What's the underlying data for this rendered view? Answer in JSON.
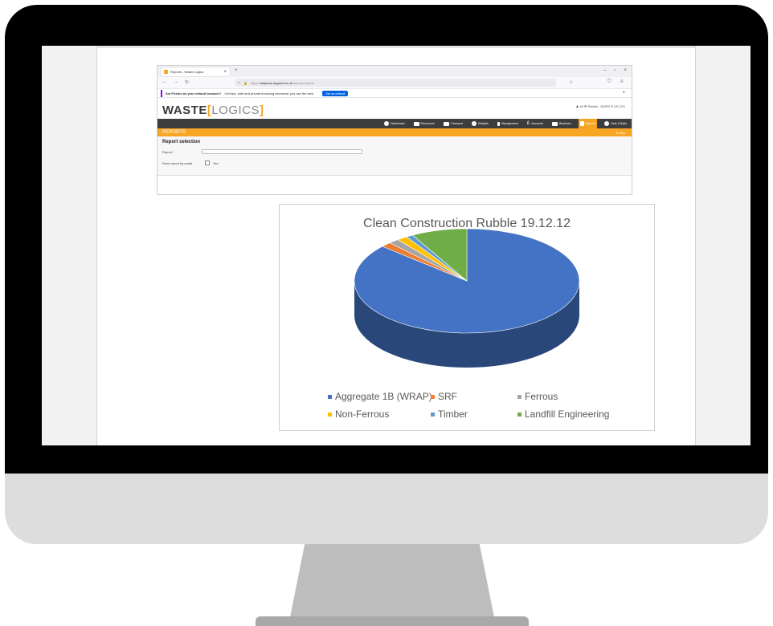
{
  "browser": {
    "tab_title": "Reports - Waste Logics",
    "tab_close": "×",
    "new_tab": "+",
    "win_minimize": "–",
    "win_maximize": "▫",
    "win_close": "×",
    "url_prefix": "https://",
    "url_host": "skipsrus.myyard.co.uk",
    "url_path": "/reports/reports",
    "notification_bold": "Set Firefox as your default browser?",
    "notification_text": "Get fast, safe and private browsing whenever you use the web.",
    "notification_button": "Set as default",
    "notification_close": "×"
  },
  "site": {
    "logo_waste": "WASTE",
    "logo_open": "[",
    "logo_logics": "LOGICS",
    "logo_close": "]",
    "account_text": "♟ 45  ⚙ Patrick . SKIPS R US LTD",
    "nav": [
      {
        "label": "Dashboard",
        "icon": "speedometer-icon"
      },
      {
        "label": "Resources",
        "icon": "grid-icon"
      },
      {
        "label": "Transport",
        "icon": "truck-icon"
      },
      {
        "label": "Weights",
        "icon": "scale-icon"
      },
      {
        "label": "Management",
        "icon": "person-icon"
      },
      {
        "label": "Accounts",
        "icon": "pound-icon"
      },
      {
        "label": "Business",
        "icon": "briefcase-icon"
      },
      {
        "label": "Reports",
        "icon": "document-icon",
        "active": true
      },
      {
        "label": "Nuts & Bolts",
        "icon": "gear-icon"
      }
    ],
    "section_title": "REPORTS",
    "help": "ℹ Help",
    "form_title": "Report selection",
    "report_label": "Report *",
    "report_value": "-----",
    "email_label": "Send report by email",
    "email_option": "Yes"
  },
  "chart_data": {
    "type": "pie",
    "title": "Clean Construction Rubble 19.12.12",
    "categories": [
      "Aggregate 1B (WRAP)",
      "SRF",
      "Ferrous",
      "Non-Ferrous",
      "Timber",
      "Landfill Engineering"
    ],
    "values": [
      86.5,
      1.5,
      1.5,
      1.5,
      1.0,
      8.0
    ],
    "colors": [
      "#4472c4",
      "#ed7d31",
      "#a5a5a5",
      "#ffc000",
      "#5b9bd5",
      "#70ad47"
    ],
    "legend_position": "bottom"
  }
}
